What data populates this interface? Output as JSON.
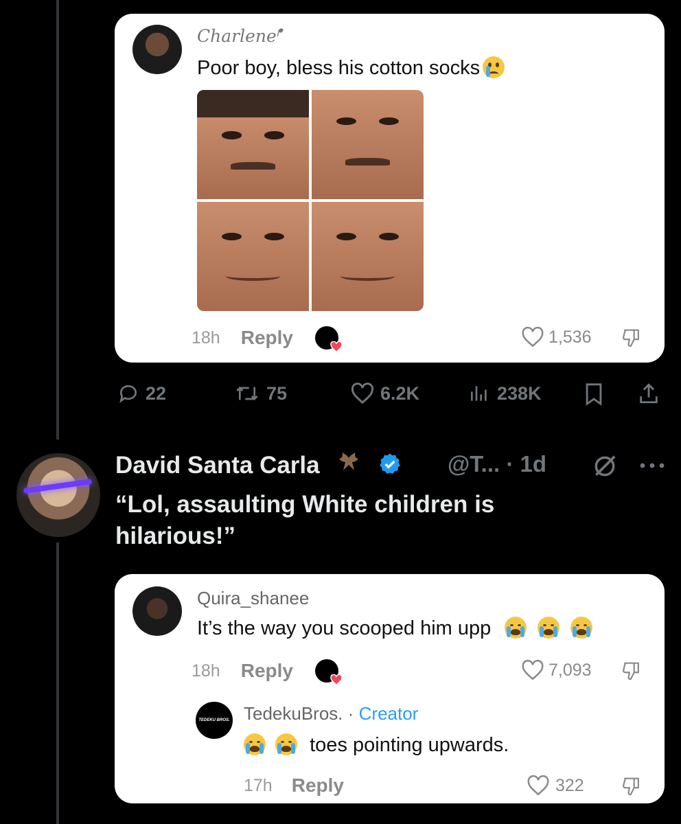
{
  "first_card": {
    "username": "Charlene",
    "username_suffix": "ᖰ",
    "comment": "Poor boy, bless his cotton socks",
    "time": "18h",
    "reply_label": "Reply",
    "like_count": "1,536"
  },
  "stats": {
    "replies": "22",
    "reposts": "75",
    "likes": "6.2K",
    "views": "238K"
  },
  "tweet": {
    "display_name": "David Santa Carla",
    "handle_time": "@T... · 1d",
    "text": "“Lol, assaulting White children is hilarious!”"
  },
  "second_card": {
    "username": "Quira_shanee",
    "comment": "It’s the way you scooped him upp",
    "time": "18h",
    "reply_label": "Reply",
    "like_count": "7,093",
    "reply": {
      "avatar_text": "TEDEKU BROS.",
      "username": "TedekuBros.",
      "separator": " · ",
      "creator_label": "Creator",
      "text": "toes pointing upwards.",
      "time": "17h",
      "reply_label": "Reply",
      "like_count": "322"
    }
  },
  "colors": {
    "background": "#000000",
    "card": "#ffffff",
    "accent_blue": "#1d9bf0",
    "creator_blue": "#2a9df4",
    "muted": "#71767b"
  },
  "icons": [
    "reply-icon",
    "repost-icon",
    "heart-icon",
    "views-icon",
    "bookmark-icon",
    "share-icon",
    "verified-icon",
    "bat-icon",
    "grok-icon",
    "more-icon",
    "dislike-icon",
    "sob-emoji-icon",
    "crying-emoji-icon"
  ]
}
